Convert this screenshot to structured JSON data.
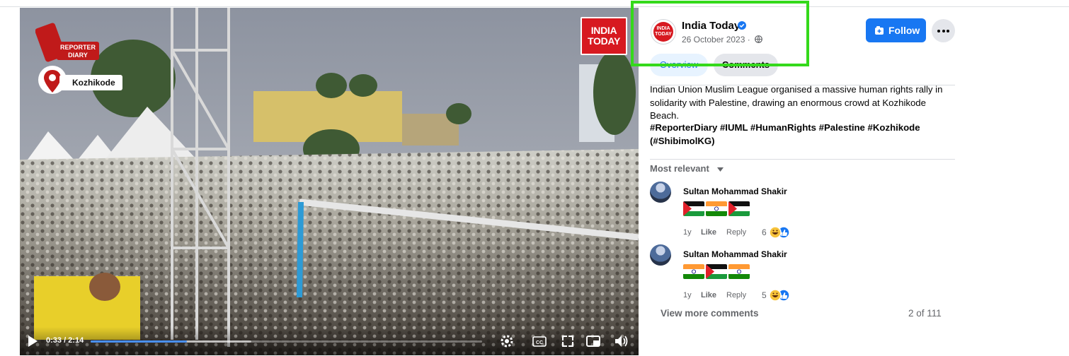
{
  "video": {
    "brand_logo": "REPORTER\nDIARY",
    "location": "Kozhikode",
    "channel_logo": "INDIA\nTODAY",
    "time_display": "0:33 / 2:14",
    "progress_fraction": 0.246,
    "controls": [
      "play-icon",
      "settings-icon",
      "captions-icon",
      "fullscreen-icon",
      "picture-in-picture-icon",
      "volume-icon"
    ]
  },
  "post": {
    "page_name": "India Today",
    "page_logo": "INDIA\nTODAY",
    "date": "26 October 2023 ·",
    "follow_label": "Follow",
    "tabs": [
      "Overview",
      "Comments"
    ],
    "description": "Indian Union Muslim League organised a massive human rights rally in solidarity with Palestine, drawing an enormous crowd at Kozhikode Beach.",
    "hashtags": "#ReporterDiary #IUML #HumanRights #Palestine #Kozhikode (#ShibimolKG)",
    "sort_label": "Most relevant"
  },
  "comments": [
    {
      "author": "Sultan Mohammad Shakir",
      "flags": [
        "palestine",
        "india",
        "palestine"
      ],
      "age": "1y",
      "like": "Like",
      "reply": "Reply",
      "reactions": "6"
    },
    {
      "author": "Sultan Mohammad Shakir",
      "flags": [
        "india",
        "palestine",
        "india"
      ],
      "age": "1y",
      "like": "Like",
      "reply": "Reply",
      "reactions": "5"
    }
  ],
  "footer": {
    "view_more": "View more comments",
    "count": "2 of 111"
  },
  "colors": {
    "accent": "#1877f2",
    "highlight": "#34d91b",
    "brand_red": "#d71920"
  }
}
